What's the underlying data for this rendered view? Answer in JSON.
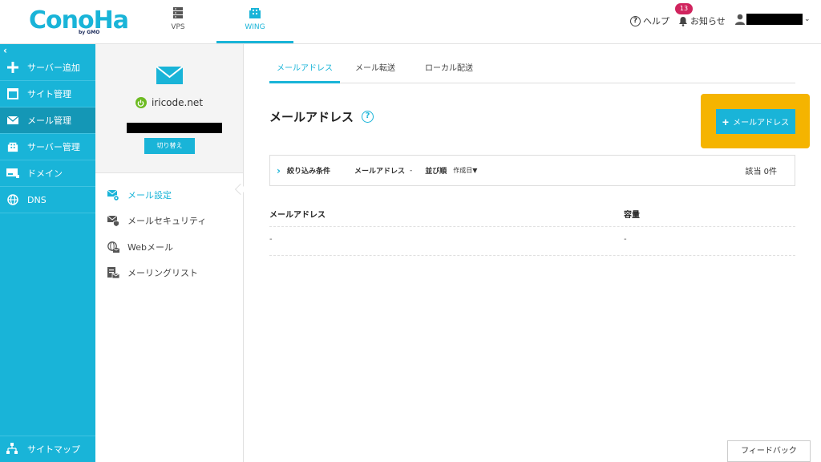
{
  "header": {
    "logo_text": "ConoHa",
    "logo_sub": "by GMO",
    "nav": [
      {
        "label": "VPS",
        "icon": "server-icon"
      },
      {
        "label": "WING",
        "icon": "building-icon",
        "active": true
      }
    ],
    "help_label": "ヘルプ",
    "notice_label": "お知らせ",
    "notice_count": "13"
  },
  "sidebar": {
    "collapse_glyph": "‹",
    "items": [
      {
        "label": "サーバー追加",
        "icon": "plus-icon"
      },
      {
        "label": "サイト管理",
        "icon": "window-icon"
      },
      {
        "label": "メール管理",
        "icon": "mail-icon",
        "active": true
      },
      {
        "label": "サーバー管理",
        "icon": "building-icon"
      },
      {
        "label": "ドメイン",
        "icon": "domain-icon"
      },
      {
        "label": "DNS",
        "icon": "globe-icon"
      }
    ],
    "sitemap_label": "サイトマップ"
  },
  "account": {
    "domain": "iricode.net",
    "switch_label": "切り替え"
  },
  "submenu": [
    {
      "label": "メール設定",
      "icon": "mail-settings-icon",
      "active": true
    },
    {
      "label": "メールセキュリティ",
      "icon": "mail-security-icon"
    },
    {
      "label": "Webメール",
      "icon": "webmail-icon"
    },
    {
      "label": "メーリングリスト",
      "icon": "mailing-list-icon"
    }
  ],
  "main": {
    "tabs": [
      {
        "label": "メールアドレス",
        "active": true
      },
      {
        "label": "メール転送"
      },
      {
        "label": "ローカル配送"
      }
    ],
    "title": "メールアドレス",
    "add_button_label": "メールアドレス",
    "filter": {
      "label": "絞り込み条件",
      "mail_label": "メールアドレス",
      "mail_value": "-",
      "sort_label": "並び順",
      "sort_value": "作成日▼",
      "count": "該当 0件"
    },
    "table": {
      "columns": [
        "メールアドレス",
        "容量"
      ],
      "rows": [
        [
          "-",
          "-"
        ]
      ]
    },
    "feedback_label": "フィードバック"
  },
  "colors": {
    "brand": "#19b4d8",
    "highlight": "#f5b400",
    "badge": "#d0245e",
    "status_green": "#6dbb22"
  }
}
